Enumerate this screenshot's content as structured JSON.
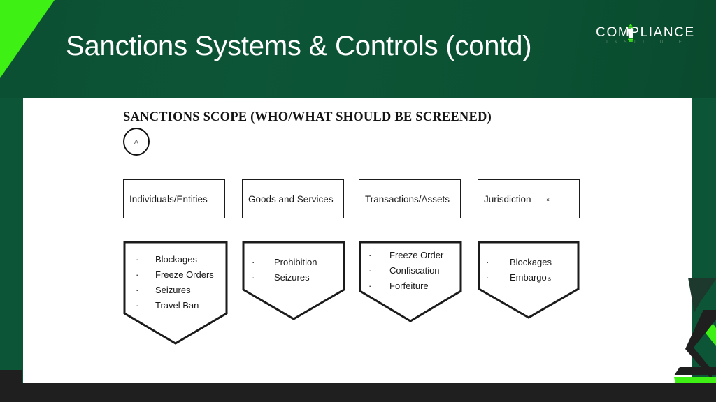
{
  "slide": {
    "title": "Sanctions Systems & Controls (contd)",
    "colors": {
      "header_green": "#0d5537",
      "accent_green": "#3ef014",
      "panel_white": "#ffffff",
      "bottom_black": "#201f1f",
      "outline_black": "#1b1b1b"
    }
  },
  "logo": {
    "word": "COMPLIANCE",
    "subtitle": "I N S T I T U T E",
    "icon": "lamp-icon"
  },
  "content": {
    "heading": "SANCTIONS SCOPE (WHO/WHAT SHOULD BE SCREENED)",
    "anchor_label": "A",
    "top_boxes": [
      {
        "label": "Individuals/Entities",
        "sup": ""
      },
      {
        "label": "Goods and Services",
        "sup": ""
      },
      {
        "label": "Transactions/Assets",
        "sup": ""
      },
      {
        "label": "Jurisdiction",
        "sup": "s"
      }
    ],
    "pentagons": [
      {
        "items": [
          {
            "text": "Blockages",
            "sup": ""
          },
          {
            "text": "Freeze Orders",
            "sup": ""
          },
          {
            "text": "Seizures",
            "sup": ""
          },
          {
            "text": "Travel Ban",
            "sup": ""
          }
        ]
      },
      {
        "items": [
          {
            "text": "Prohibition",
            "sup": ""
          },
          {
            "text": "Seizures",
            "sup": ""
          }
        ]
      },
      {
        "items": [
          {
            "text": "Freeze  Order",
            "sup": ""
          },
          {
            "text": "Confiscation",
            "sup": ""
          },
          {
            "text": "Forfeiture",
            "sup": ""
          }
        ]
      },
      {
        "items": [
          {
            "text": "Blockages",
            "sup": ""
          },
          {
            "text": "Embargo",
            "sup": "s"
          }
        ]
      }
    ],
    "bullet_glyph": "·"
  }
}
